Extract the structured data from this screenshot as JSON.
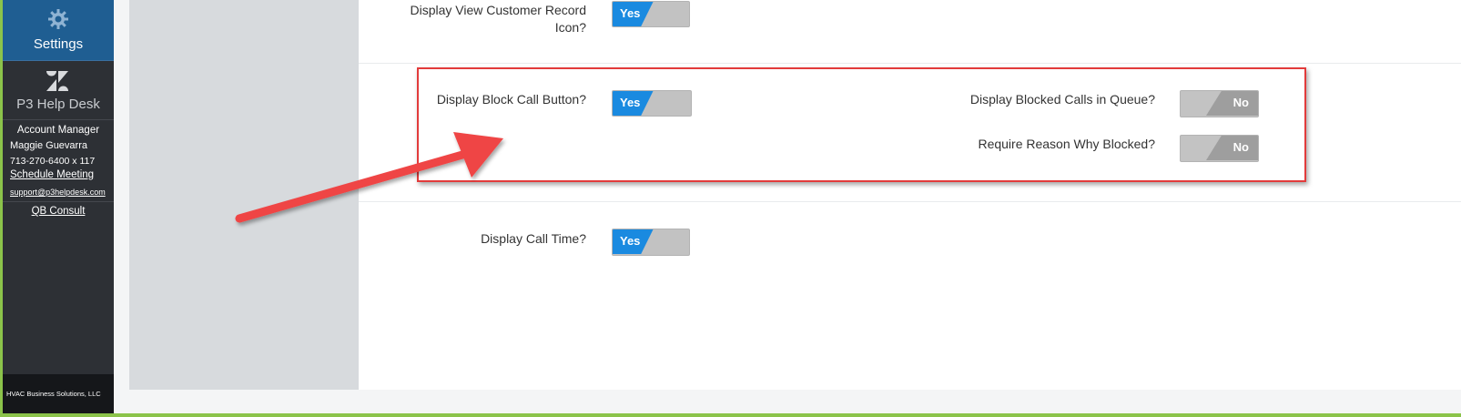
{
  "sidebar": {
    "settings_label": "Settings",
    "helpdesk_label": "P3 Help Desk",
    "account_manager": {
      "title": "Account Manager",
      "name": "Maggie Guevarra",
      "phone": "713-270-6400 x 117",
      "schedule_link": "Schedule Meeting",
      "email": "support@p3helpdesk.com",
      "consult_link": "QB Consult"
    },
    "footer_brand": "HVAC Business Solutions, LLC"
  },
  "settings": {
    "view_customer": {
      "label": "Display View Customer Record Icon?",
      "value": "Yes"
    },
    "block_call": {
      "label": "Display Block Call Button?",
      "value": "Yes"
    },
    "blocked_in_queue": {
      "label": "Display Blocked Calls in Queue?",
      "value": "No"
    },
    "require_reason": {
      "label": "Require Reason Why Blocked?",
      "value": "No"
    },
    "call_time": {
      "label": "Display Call Time?",
      "value": "Yes"
    }
  },
  "colors": {
    "accent_blue": "#1a8ae0",
    "sidebar_bg": "#2d3035",
    "settings_tile": "#1f5e92",
    "callout_red": "#e23b3b"
  }
}
